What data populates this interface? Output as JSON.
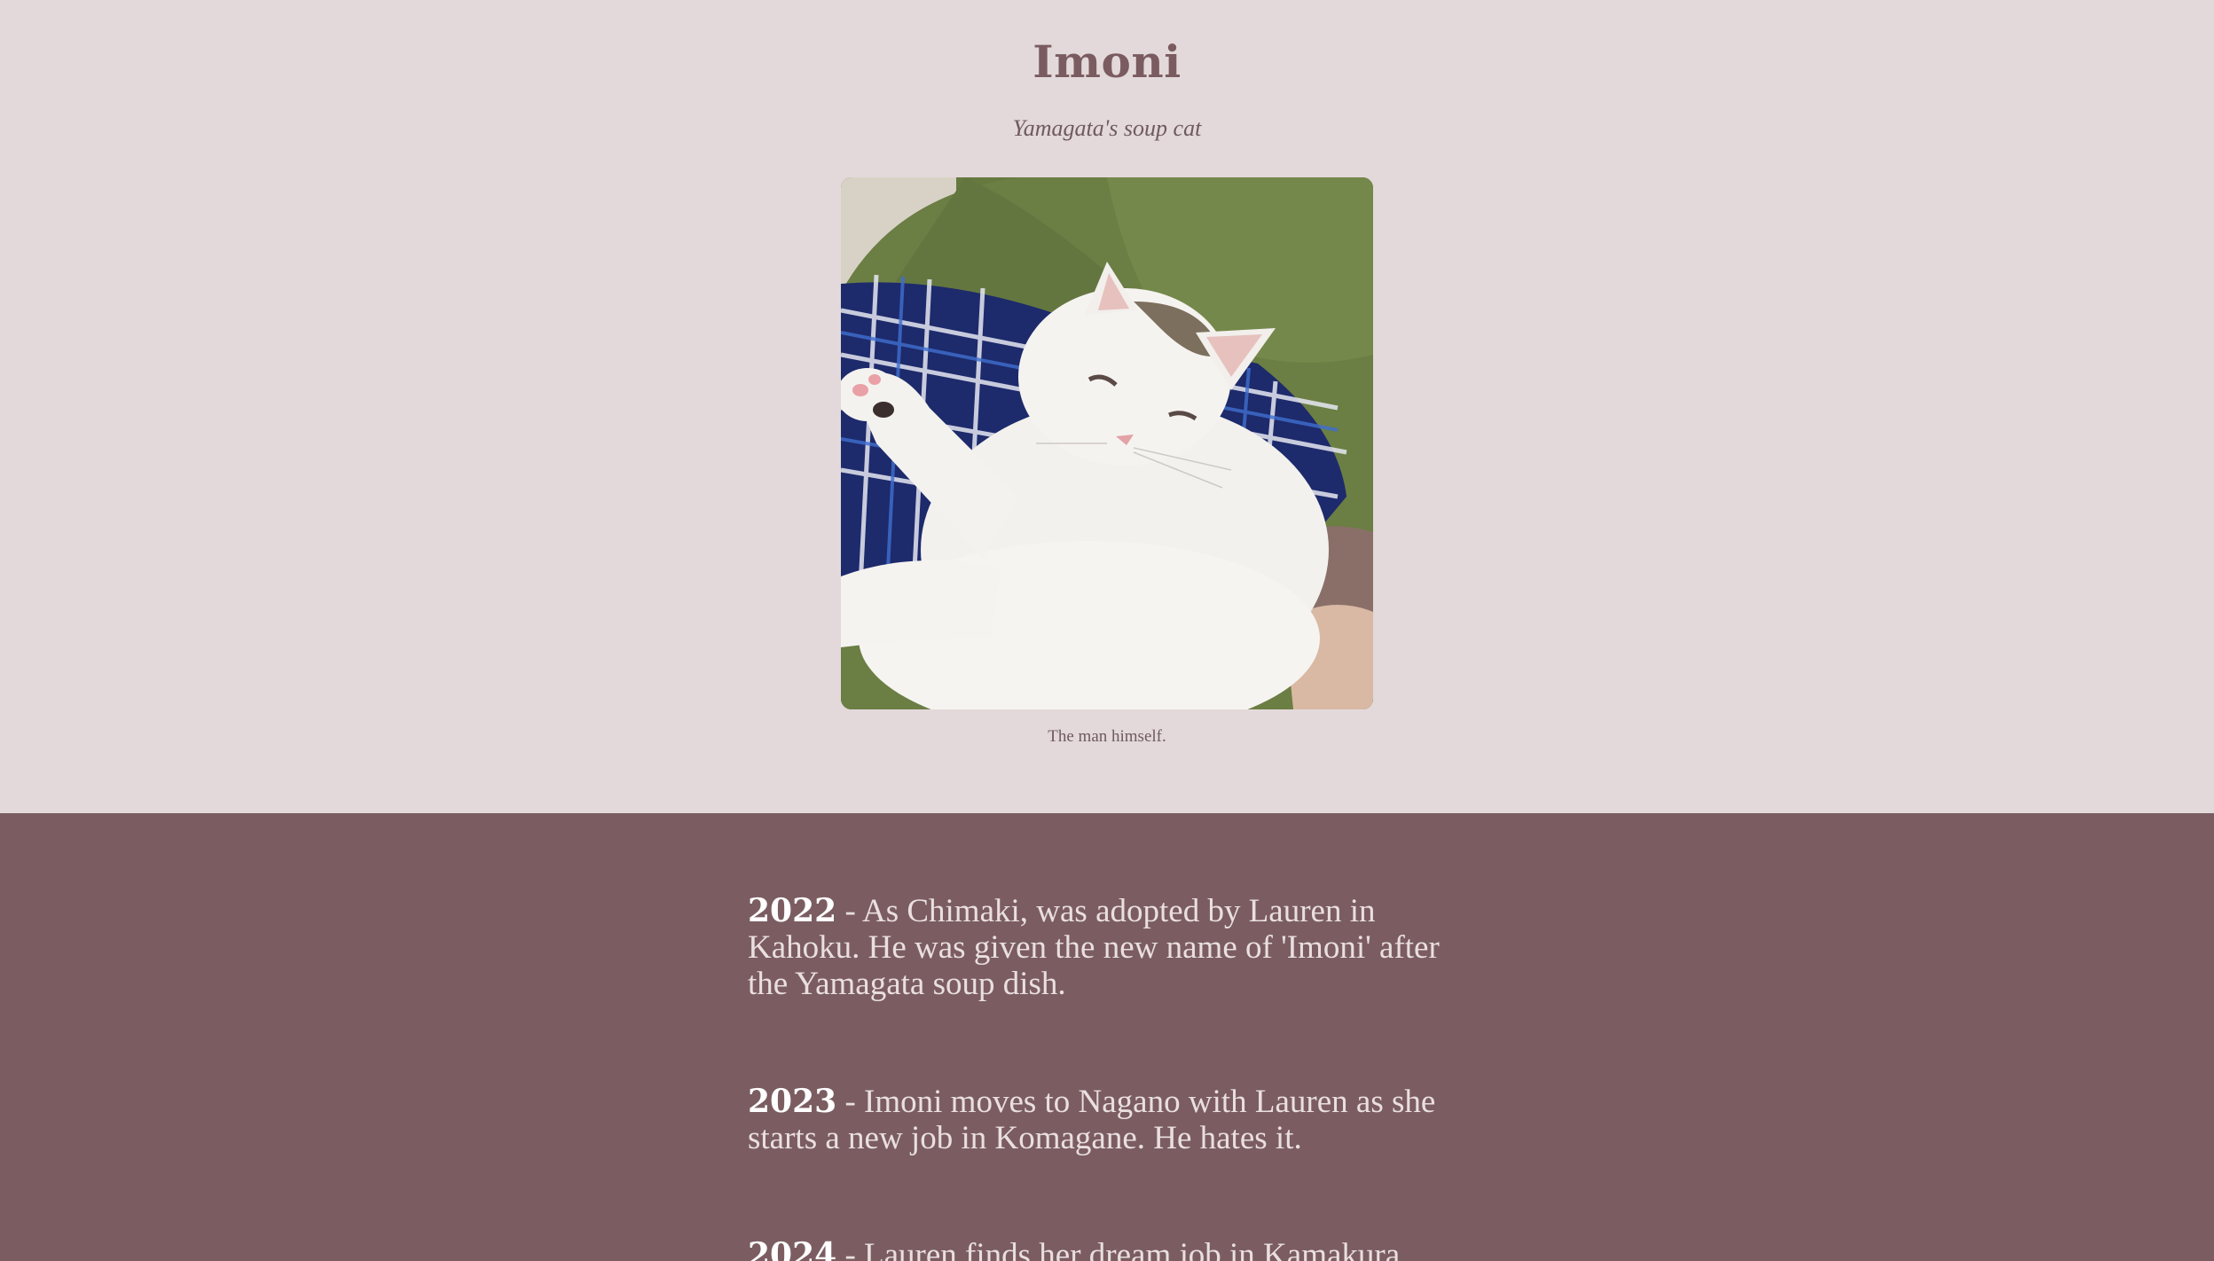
{
  "header": {
    "title": "Imoni",
    "subtitle": "Yamagata's soup cat"
  },
  "photo": {
    "caption": "The man himself."
  },
  "timeline": {
    "entries": [
      {
        "year": "2022",
        "separator": " - ",
        "text": "As Chimaki, was adopted by Lauren in Kahoku. He was given the new name of 'Imoni' after the Yamagata soup dish."
      },
      {
        "year": "2023",
        "separator": " - ",
        "text": "Imoni moves to Nagano with Lauren as she starts a new job in Komagane. He hates it."
      },
      {
        "year": "2024",
        "separator": " - ",
        "text": "Lauren finds her dream job in Kamakura"
      }
    ]
  },
  "colors": {
    "page_background": "#e3d9da",
    "title": "#7a5c60",
    "timeline_background": "#7b5d61",
    "timeline_text": "#eadfe0"
  }
}
